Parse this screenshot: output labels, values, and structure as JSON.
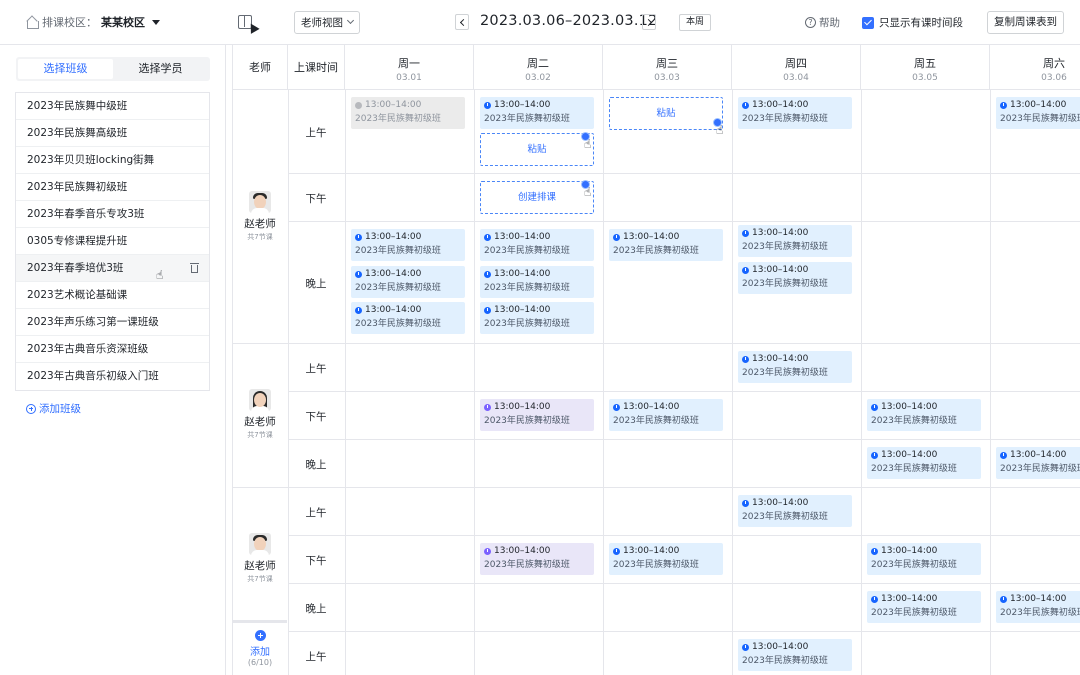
{
  "topbar": {
    "campus_label": "排课校区：",
    "campus_value": "某某校区",
    "view_select": "老师视图",
    "date_range": "2023.03.06–2023.03.12",
    "this_week": "本周",
    "help": "帮助",
    "only_show_label": "只显示有课时间段",
    "copy_button": "复制周课表到"
  },
  "sidebar": {
    "tabs": [
      "选择班级",
      "选择学员"
    ],
    "classes": [
      "2023年民族舞中级班",
      "2023年民族舞高级班",
      "2023年贝贝班locking街舞",
      "2023年民族舞初级班",
      "2023年春季音乐专攻3班",
      "0305专修课程提升班",
      "2023年春季培优3班",
      "2023艺术概论基础课",
      "2023年声乐练习第一课班级",
      "2023年古典音乐资深班级",
      "2023年古典音乐初级入门班"
    ],
    "add_class": "添加班级"
  },
  "grid": {
    "col_teacher": "老师",
    "col_time": "上课时间",
    "days": [
      {
        "day": "周一",
        "date": "03.01"
      },
      {
        "day": "周二",
        "date": "03.02"
      },
      {
        "day": "周三",
        "date": "03.03"
      },
      {
        "day": "周四",
        "date": "03.04"
      },
      {
        "day": "周五",
        "date": "03.05"
      },
      {
        "day": "周六",
        "date": "03.06"
      }
    ],
    "slots": {
      "morning": "上午",
      "afternoon": "下午",
      "evening": "晚上"
    },
    "teachers": [
      {
        "name": "赵老师",
        "count": "共7节课"
      },
      {
        "name": "赵老师",
        "count": "共7节课"
      },
      {
        "name": "赵老师",
        "count": "共7节课"
      }
    ],
    "lesson_time": "13:00–14:00",
    "lesson_class": "2023年民族舞初级班",
    "paste": "粘贴",
    "create": "创建排课",
    "add_teacher": "添加",
    "add_teacher_count": "(6/10)"
  }
}
